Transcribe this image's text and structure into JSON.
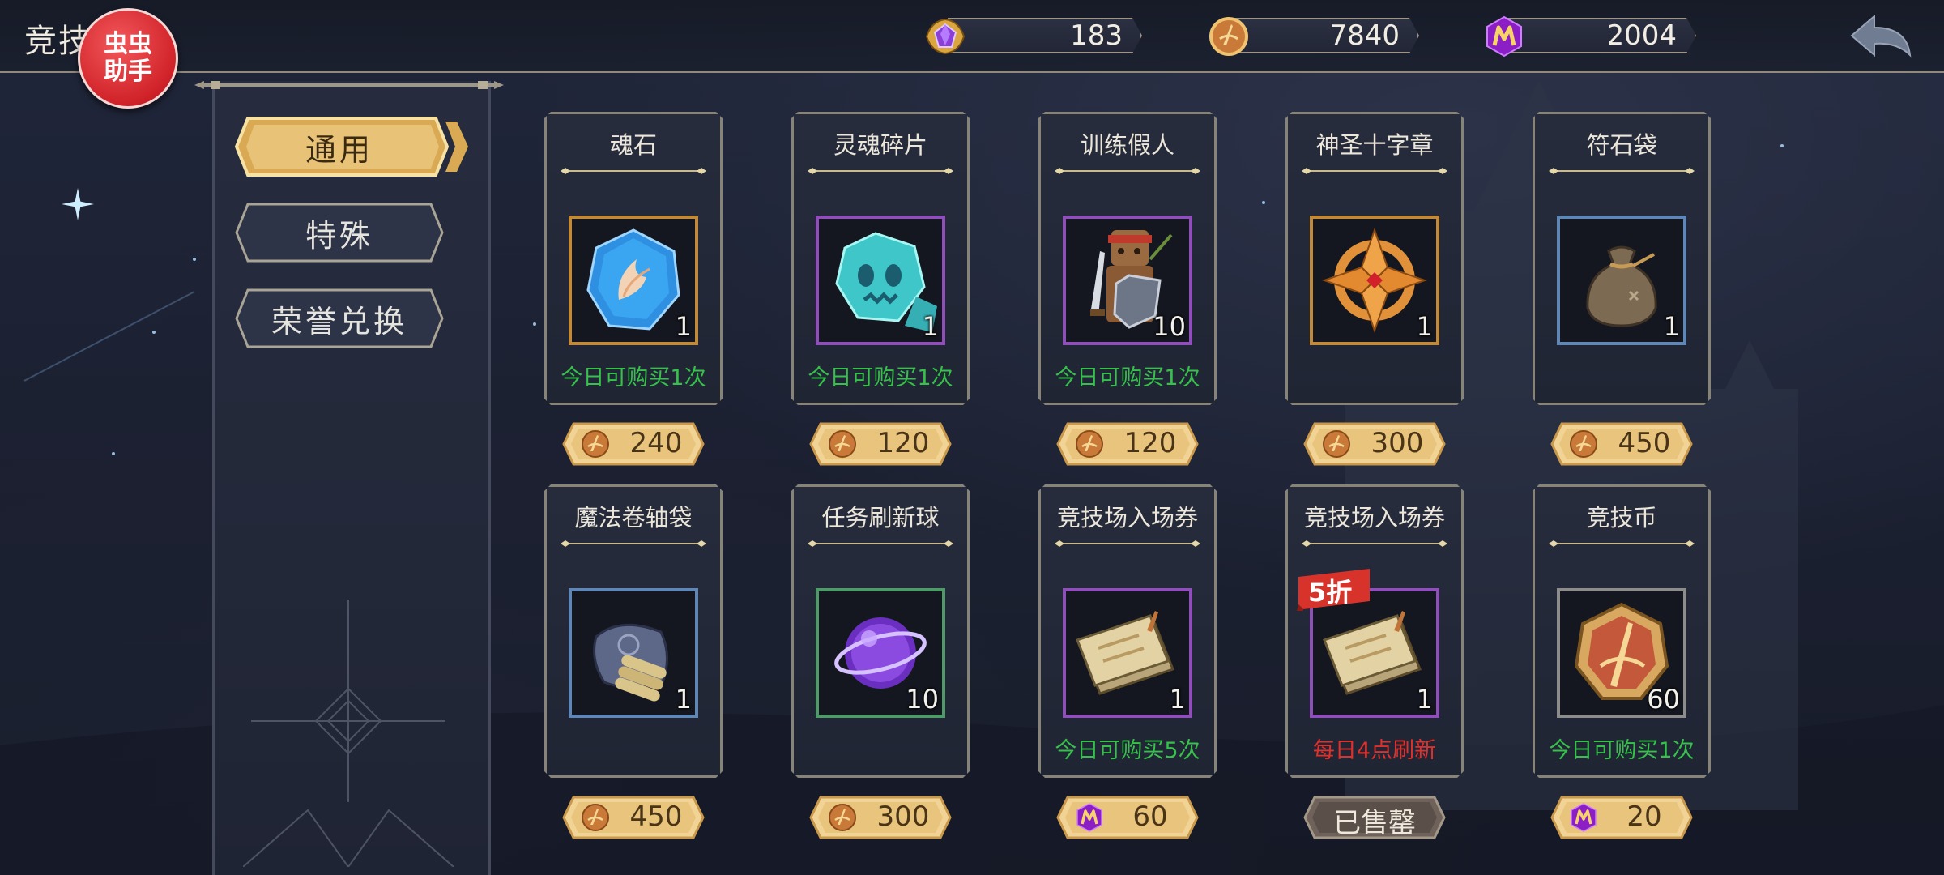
{
  "header": {
    "title": "竞技",
    "badge_line1": "虫虫",
    "badge_line2": "助手"
  },
  "currencies": [
    {
      "icon": "purple-gem-icon",
      "value": "183"
    },
    {
      "icon": "arena-coin-icon",
      "value": "7840"
    },
    {
      "icon": "m-token-icon",
      "value": "2004"
    }
  ],
  "tabs": [
    {
      "label": "通用",
      "active": true
    },
    {
      "label": "特殊",
      "active": false
    },
    {
      "label": "荣誉兑换",
      "active": false
    }
  ],
  "items": [
    {
      "name": "魂石",
      "icon": "soul-stone-icon",
      "qty": "1",
      "limit": "今日可购买1次",
      "price": "240",
      "currency": "arena-coin-icon",
      "rarity": "gold"
    },
    {
      "name": "灵魂碎片",
      "icon": "soul-fragment-icon",
      "qty": "1",
      "limit": "今日可购买1次",
      "price": "120",
      "currency": "arena-coin-icon",
      "rarity": "purple"
    },
    {
      "name": "训练假人",
      "icon": "training-dummy-icon",
      "qty": "10",
      "limit": "今日可购买1次",
      "price": "120",
      "currency": "arena-coin-icon",
      "rarity": "purple"
    },
    {
      "name": "神圣十字章",
      "icon": "holy-cross-icon",
      "qty": "1",
      "limit": "",
      "price": "300",
      "currency": "arena-coin-icon",
      "rarity": "gold"
    },
    {
      "name": "符石袋",
      "icon": "rune-bag-icon",
      "qty": "1",
      "limit": "",
      "price": "450",
      "currency": "arena-coin-icon",
      "rarity": "blue"
    },
    {
      "name": "魔法卷轴袋",
      "icon": "scroll-bag-icon",
      "qty": "1",
      "limit": "",
      "price": "450",
      "currency": "arena-coin-icon",
      "rarity": "blue"
    },
    {
      "name": "任务刷新球",
      "icon": "refresh-orb-icon",
      "qty": "10",
      "limit": "",
      "price": "300",
      "currency": "arena-coin-icon",
      "rarity": "green"
    },
    {
      "name": "竞技场入场券",
      "icon": "arena-ticket-icon",
      "qty": "1",
      "limit": "今日可购买5次",
      "price": "60",
      "currency": "m-token-icon",
      "rarity": "purple"
    },
    {
      "name": "竞技场入场券",
      "icon": "arena-ticket-icon",
      "qty": "1",
      "limit": "每日4点刷新",
      "price": "已售罄",
      "currency": "",
      "rarity": "purple",
      "discount": "5折",
      "sold_out": true
    },
    {
      "name": "竞技币",
      "icon": "arena-coin-icon",
      "qty": "60",
      "limit": "今日可购买1次",
      "price": "20",
      "currency": "m-token-icon",
      "rarity": "gray"
    }
  ],
  "colors": {
    "limit_green": "#36c24a",
    "limit_red": "#e0302c",
    "gold": "#e8c577",
    "frame": "#878377"
  }
}
